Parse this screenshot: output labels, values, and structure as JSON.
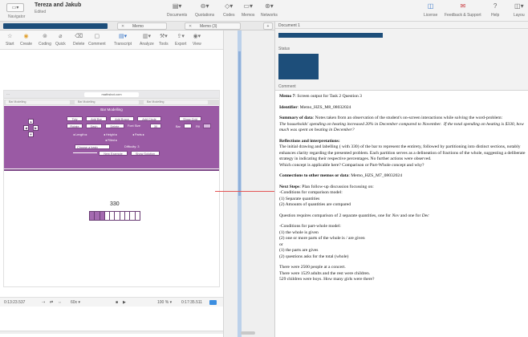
{
  "window": {
    "navigator_label": "Navigator",
    "project_title": "Tereza and Jakub",
    "project_sub": "Edited"
  },
  "top_toolbar": [
    {
      "label": "Documents",
      "icon": "document-icon"
    },
    {
      "label": "Quotations",
      "icon": "quotation-icon"
    },
    {
      "label": "Codes",
      "icon": "code-icon"
    },
    {
      "label": "Memos",
      "icon": "memo-icon"
    },
    {
      "label": "Networks",
      "icon": "network-icon"
    },
    {
      "label": "License",
      "icon": "license-icon"
    },
    {
      "label": "Feedback & Support",
      "icon": "feedback-icon"
    },
    {
      "label": "Help",
      "icon": "help-icon"
    },
    {
      "label": "Layou",
      "icon": "layout-icon"
    }
  ],
  "tabs": {
    "memo": "Memo",
    "memo2": "Memo (3)"
  },
  "memo_toolbar": [
    {
      "label": "Start",
      "icon": "start-icon"
    },
    {
      "label": "Create",
      "icon": "create-icon"
    },
    {
      "label": "Coding",
      "icon": "coding-icon"
    },
    {
      "label": "Quick",
      "icon": "quick-icon"
    },
    {
      "label": "Delete",
      "icon": "delete-icon"
    },
    {
      "label": "Comment",
      "icon": "comment-icon"
    },
    {
      "label": "Transcript",
      "icon": "transcript-icon"
    },
    {
      "label": "Analyze",
      "icon": "analyze-icon"
    },
    {
      "label": "Tools",
      "icon": "tools-icon"
    },
    {
      "label": "Export",
      "icon": "export-icon"
    },
    {
      "label": "View",
      "icon": "view-icon"
    }
  ],
  "right_panel": {
    "doc_header": "Document 1",
    "status_label": "Status",
    "comment_label": "Comment"
  },
  "screenshot": {
    "url": "mathsbot.com",
    "tab1": "Bar Modelling",
    "tab2": "Bar Modelling",
    "title": "Bar Modelling",
    "buttons": [
      "Tidy",
      "Add Bar",
      "Add Brace",
      "Add Circle",
      "Rotate",
      "Dash",
      "Delete",
      "Font Size"
    ],
    "font_size_value": "30",
    "show_grid": "Show Grid",
    "bar_label": "Bar",
    "fill_label": "Fill",
    "length_label": "Length",
    "height_label": "Height",
    "parts_label": "Parts",
    "filled_label": "Filled",
    "choose_basic": "Choose a basic",
    "difficulty": "Difficulty: 3",
    "new_example": "New Example",
    "show_solution": "Show Solution",
    "bar_value": "330",
    "bar_parts": 10,
    "bar_filled": 3
  },
  "playback": {
    "time_current": "0:13:23.537",
    "speed": "60x",
    "zoom": "100 %",
    "time_total": "0:17:35.511"
  },
  "memo": {
    "title_bold": "Memo 7",
    "title_rest": ": Screen output for Task 2 Question 3",
    "identifier_label": "Identifier",
    "identifier_value": ": Memo_HZS_M8_08032024",
    "summary_label": "Summary of data",
    "summary_text": ": Notes taken from an observation of the student's on-screen interactions while solving the word-problem:",
    "summary_italic": "The households' spending on heating increased 20% in December compared to November.  If the total spending on heating is $330, how much was spent on heating in December?",
    "reflections_label": "Reflections and interpretations",
    "reflections_text": "The initial drawing and labelling ( with 330) of the bar to represent the entirety, followed by partitioning into distinct sections, notably enhances clarity regarding the presented problem. Each partition serves as a delineation of fractions of the whole, suggesting a deliberate strategy in indicating their respective percentages. No further actions were observed.\nWhich concept is applicable here? Comparison or Part-Whole concept and why?",
    "connections_label": "Connections to other memos or data",
    "connections_text": ": Memo_HZS_M7_08032024",
    "next_label": "Next Steps",
    "next_text": ": Plan follow-up discussion focussing on:\n-Conditions for comparison model:\n(1) Separate quantities\n(2) Amounts of quantities are compared",
    "question_text": "Question requires comparison of 2 separate quantities, one for ",
    "question_nov": "Nov",
    "question_and": " and one for ",
    "question_dec": "Dec",
    "partwhole_text": "-Conditions for part-whole model:\n(1) the whole is given\n(2) one or more parts of the whole is / are given\nor\n(1) the parts are gives\n(2) questions asks for the total (whole)",
    "example_text": "There were 2500 people at a concert.\nThere were 1529 adults and the rest were children.\n529 children were boys. How many girls were there?"
  }
}
